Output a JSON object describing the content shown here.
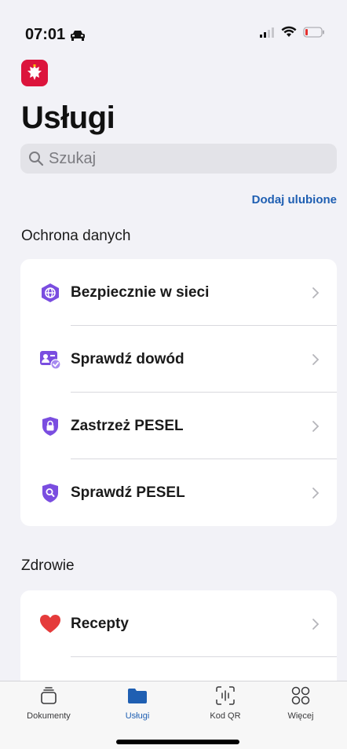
{
  "status": {
    "time": "07:01"
  },
  "page": {
    "title": "Usługi",
    "search_placeholder": "Szukaj",
    "favorites_link": "Dodaj ulubione"
  },
  "sections": [
    {
      "title": "Ochrona danych",
      "items": [
        {
          "label": "Bezpiecznie w sieci",
          "icon": "globe-shield-icon"
        },
        {
          "label": "Sprawdź dowód",
          "icon": "id-card-check-icon"
        },
        {
          "label": "Zastrzeż PESEL",
          "icon": "lock-shield-icon"
        },
        {
          "label": "Sprawdź PESEL",
          "icon": "search-shield-icon"
        }
      ]
    },
    {
      "title": "Zdrowie",
      "items": [
        {
          "label": "Recepty",
          "icon": "heart-icon"
        }
      ]
    }
  ],
  "tabs": [
    {
      "label": "Dokumenty",
      "icon": "documents-icon"
    },
    {
      "label": "Usługi",
      "icon": "folder-icon",
      "active": true
    },
    {
      "label": "Kod QR",
      "icon": "qr-scan-icon"
    },
    {
      "label": "Więcej",
      "icon": "grid-more-icon"
    }
  ],
  "colors": {
    "accent": "#1f5fb2",
    "purple": "#7a4de0",
    "red": "#dc143c",
    "background": "#f2f2f7"
  }
}
